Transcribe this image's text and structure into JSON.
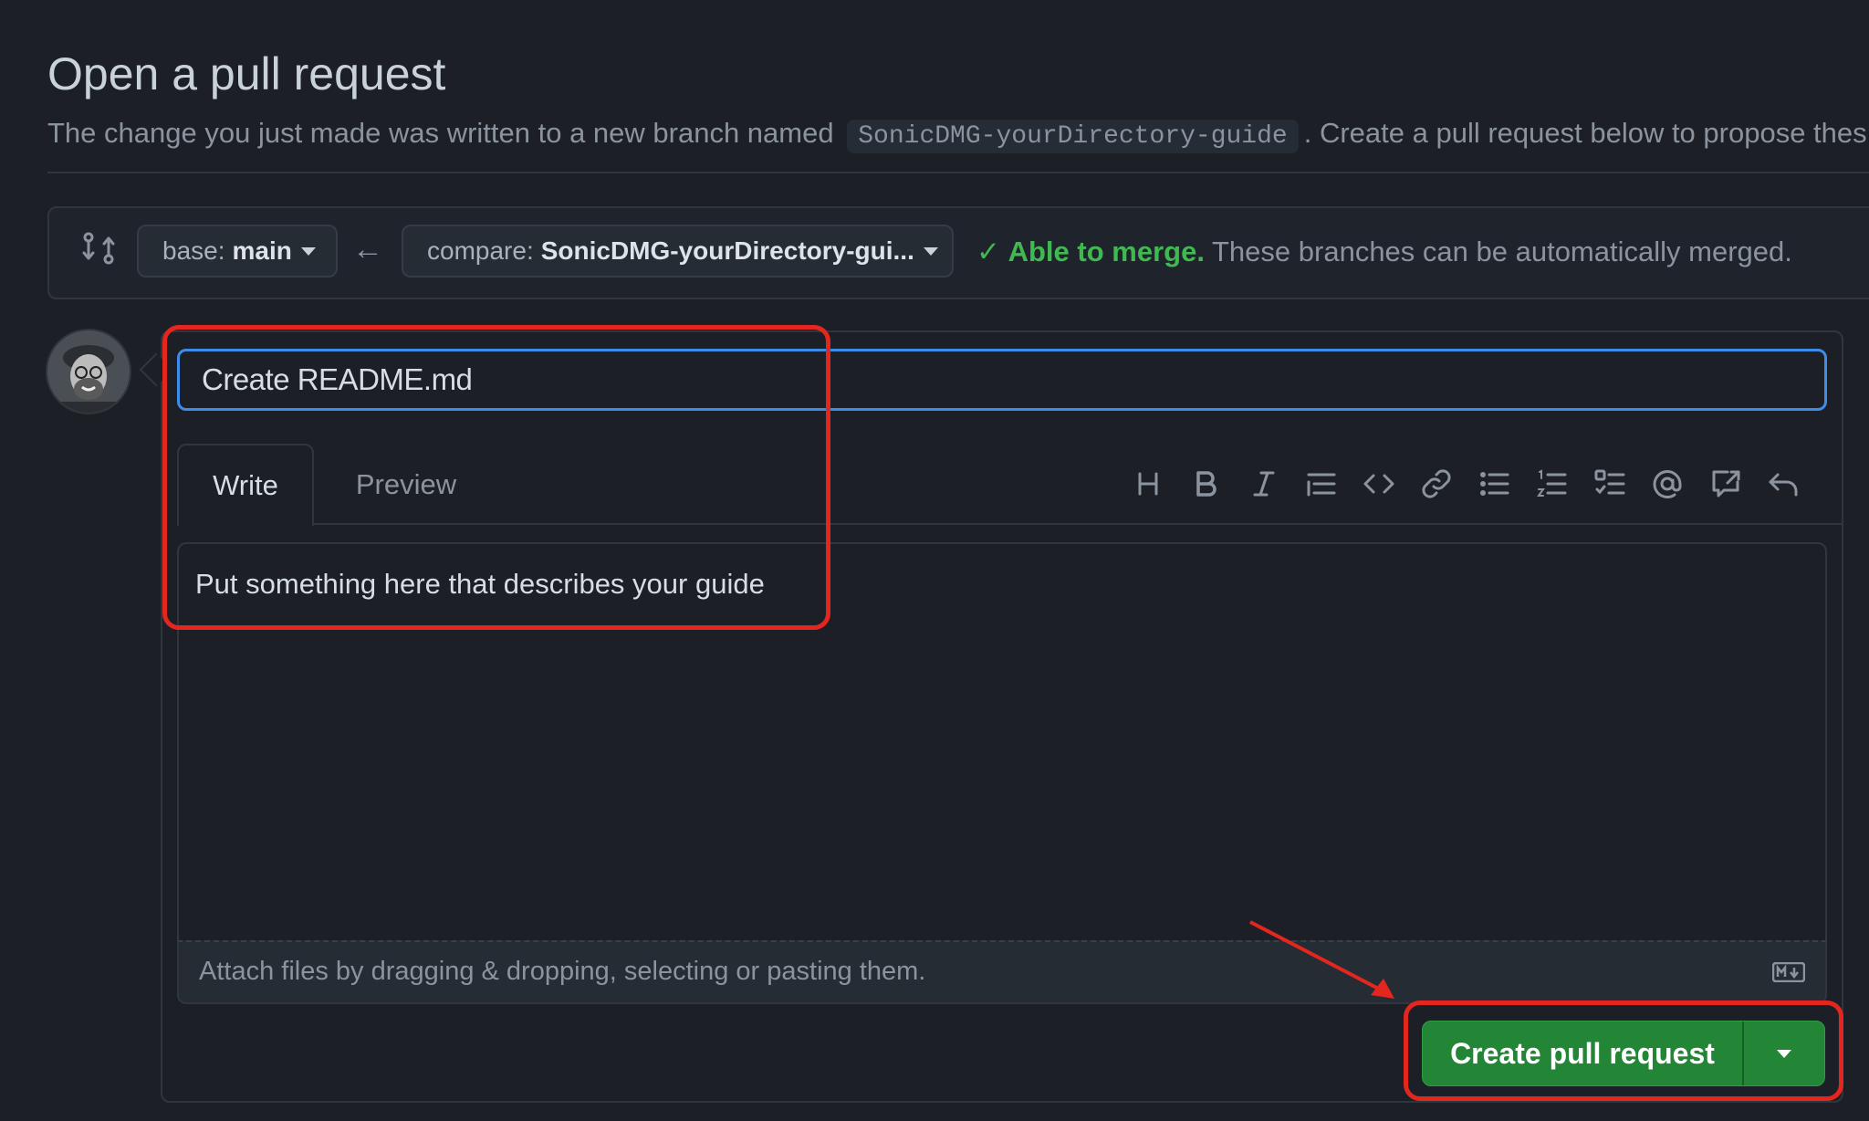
{
  "page": {
    "title": "Open a pull request",
    "subtitle_before": "The change you just made was written to a new branch named",
    "branch_name": "SonicDMG-yourDirectory-guide",
    "subtitle_after": ". Create a pull request below to propose thes"
  },
  "compare": {
    "base_key": "base:",
    "base_value": "main",
    "compare_key": "compare:",
    "compare_value": "SonicDMG-yourDirectory-gui...",
    "merge_ok": "Able to merge.",
    "merge_text": "These branches can be automatically merged."
  },
  "form": {
    "title_value": "Create README.md",
    "tabs": [
      {
        "label": "Write"
      },
      {
        "label": "Preview"
      }
    ],
    "toolbar": [
      "heading-icon",
      "bold-icon",
      "italic-icon",
      "quote-icon",
      "code-icon",
      "link-icon",
      "bullet-list-icon",
      "numbered-list-icon",
      "task-list-icon",
      "mention-icon",
      "reference-icon",
      "reply-icon"
    ],
    "body_value": "Put something here that describes your guide",
    "attach_text": "Attach files by dragging & dropping, selecting or pasting them.",
    "submit_label": "Create pull request"
  },
  "colors": {
    "accent_focus": "#3f8ce8",
    "success": "#3fb950",
    "primary_button": "#238636",
    "annotation": "#e3261e"
  }
}
